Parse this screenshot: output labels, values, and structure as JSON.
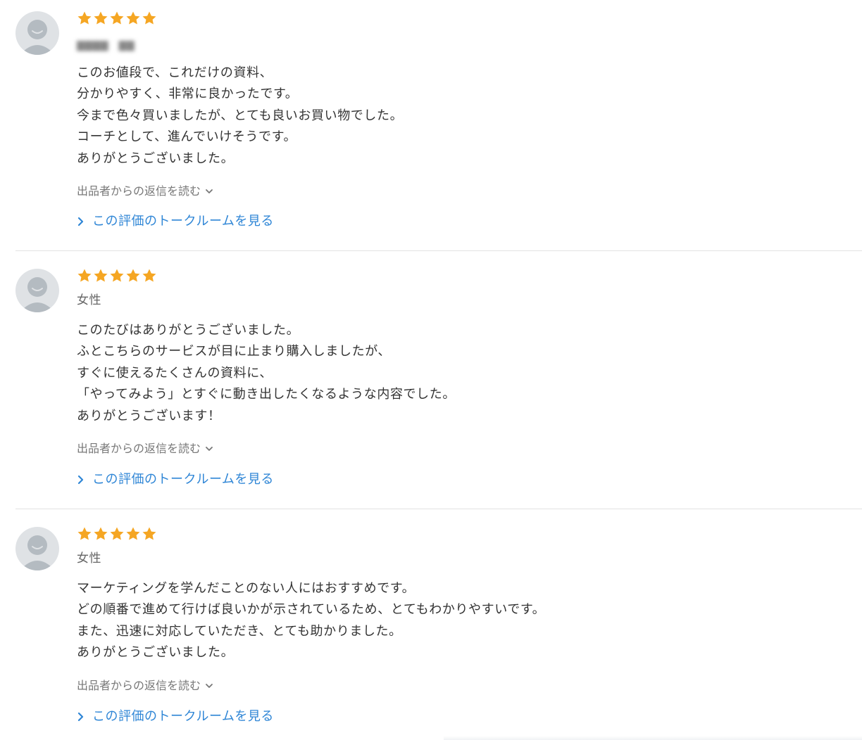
{
  "colors": {
    "star": "#f5a623",
    "link": "#2f86d6",
    "avatar_bg": "#dfe2e5",
    "avatar_fg": "#b4bbc1"
  },
  "reviews": [
    {
      "rating": 5,
      "reviewer": "",
      "reviewer_blurred": true,
      "lines": [
        "このお値段で、これだけの資料、",
        "分かりやすく、非常に良かったです。",
        "今まで色々買いましたが、とても良いお買い物でした。",
        "コーチとして、進んでいけそうです。",
        "ありがとうございました。"
      ],
      "reply_label": "出品者からの返信を読む",
      "talkroom_label": "この評価のトークルームを見る"
    },
    {
      "rating": 5,
      "reviewer": "女性",
      "reviewer_blurred": false,
      "lines": [
        "このたびはありがとうございました。",
        "ふとこちらのサービスが目に止まり購入しましたが、",
        "すぐに使えるたくさんの資料に、",
        "「やってみよう」とすぐに動き出したくなるような内容でした。",
        "ありがとうございます！"
      ],
      "reply_label": "出品者からの返信を読む",
      "talkroom_label": "この評価のトークルームを見る"
    },
    {
      "rating": 5,
      "reviewer": "女性",
      "reviewer_blurred": false,
      "lines": [
        "マーケティングを学んだことのない人にはおすすめです。",
        "どの順番で進めて行けば良いかが示されているため、とてもわかりやすいです。",
        "また、迅速に対応していただき、とても助かりました。",
        "ありがとうございました。"
      ],
      "reply_label": "出品者からの返信を読む",
      "talkroom_label": "この評価のトークルームを見る"
    }
  ]
}
